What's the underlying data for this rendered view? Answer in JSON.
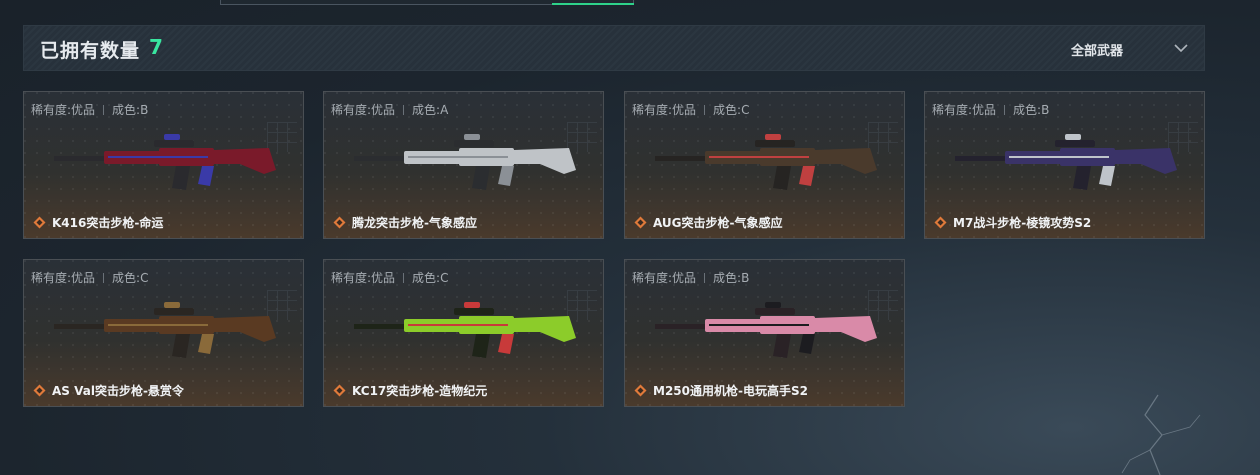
{
  "header": {
    "title": "已拥有数量",
    "count": "7",
    "filter_label": "全部武器"
  },
  "items": [
    {
      "rarity": "稀有度:优品",
      "condition": "成色:B",
      "name": "K416突击步枪-命运",
      "colors": {
        "primary": "#7a1a2a",
        "accent": "#3a3aa8",
        "metal": "#2a2a2e"
      }
    },
    {
      "rarity": "稀有度:优品",
      "condition": "成色:A",
      "name": "腾龙突击步枪-气象感应",
      "colors": {
        "primary": "#bfc3c7",
        "accent": "#8b9096",
        "metal": "#2b2d30"
      }
    },
    {
      "rarity": "稀有度:优品",
      "condition": "成色:C",
      "name": "AUG突击步枪-气象感应",
      "colors": {
        "primary": "#4a3a2c",
        "accent": "#c04040",
        "metal": "#262422"
      }
    },
    {
      "rarity": "稀有度:优品",
      "condition": "成色:B",
      "name": "M7战斗步枪-棱镜攻势S2",
      "colors": {
        "primary": "#3a3368",
        "accent": "#bfc4ca",
        "metal": "#24222e"
      }
    },
    {
      "rarity": "稀有度:优品",
      "condition": "成色:C",
      "name": "AS Val突击步枪-悬赏令",
      "colors": {
        "primary": "#5a3a22",
        "accent": "#8a6a3a",
        "metal": "#2a2622"
      }
    },
    {
      "rarity": "稀有度:优品",
      "condition": "成色:C",
      "name": "KC17突击步枪-造物纪元",
      "colors": {
        "primary": "#8ccc2a",
        "accent": "#c83a3a",
        "metal": "#1e2418"
      }
    },
    {
      "rarity": "稀有度:优品",
      "condition": "成色:B",
      "name": "M250通用机枪-电玩高手S2",
      "colors": {
        "primary": "#d98aa8",
        "accent": "#1c1c20",
        "metal": "#2a2226"
      }
    }
  ],
  "colors": {
    "accent_green": "#39e6a0",
    "rarity_orange": "#e07a3a"
  }
}
